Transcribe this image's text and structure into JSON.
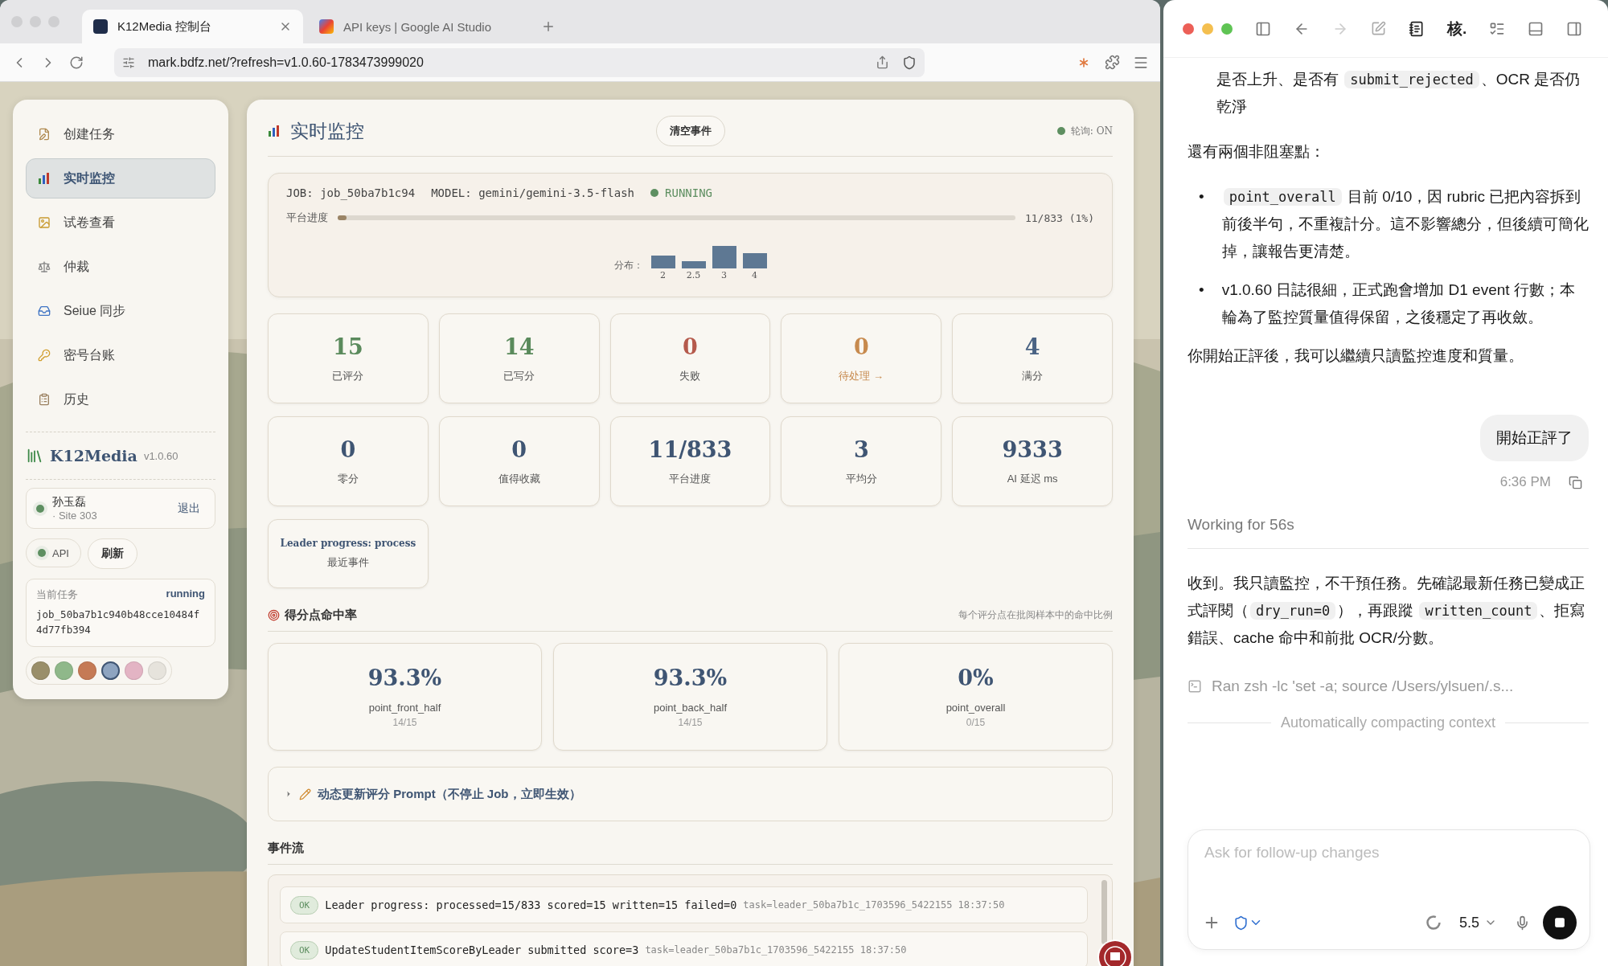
{
  "browser": {
    "tabs": [
      {
        "title": "K12Media 控制台",
        "selected": true
      },
      {
        "title": "API keys | Google AI Studio",
        "selected": false
      }
    ],
    "url": "mark.bdfz.net/?refresh=v1.0.60-1783473999020"
  },
  "sidebar": {
    "items": [
      {
        "label": "创建任务",
        "selected": false
      },
      {
        "label": "实时监控",
        "selected": true
      },
      {
        "label": "试卷查看",
        "selected": false
      },
      {
        "label": "仲裁",
        "selected": false
      },
      {
        "label": "Seiue 同步",
        "selected": false
      },
      {
        "label": "密号台账",
        "selected": false
      },
      {
        "label": "历史",
        "selected": false
      }
    ],
    "brand": {
      "name": "K12Media",
      "version": "v1.0.60"
    },
    "user": {
      "name": "孙玉磊",
      "site": "· Site 303",
      "logout": "退出"
    },
    "api_status": {
      "label": "API",
      "color": "#5e8f61"
    },
    "refresh": "刷新",
    "current_task": {
      "title": "当前任务",
      "status": "running",
      "job": "job_50ba7b1c940b48cce10484f4d77fb394"
    },
    "swatches": [
      {
        "color": "#9a8f6a",
        "selected": false
      },
      {
        "color": "#8fb88a",
        "selected": false
      },
      {
        "color": "#c57a55",
        "selected": false
      },
      {
        "color": "#8ea4c0",
        "selected": true
      },
      {
        "color": "#e3b4c4",
        "selected": false
      },
      {
        "color": "#e6e3dc",
        "selected": false
      }
    ]
  },
  "main": {
    "title": "实时监控",
    "clear_button": "清空事件",
    "polling": {
      "label": "轮询: ON",
      "color": "#5e8f61"
    },
    "job": {
      "job": "JOB: job_50ba7b1c94",
      "model": "MODEL: gemini/gemini-3.5-flash",
      "status": "RUNNING",
      "progress_label": "平台进度",
      "level": 0.013,
      "reading": "11/833 (1%)",
      "distribution_label": "分布：",
      "bins": [
        "2",
        "2.5",
        "3",
        "4"
      ]
    },
    "stats": [
      {
        "kind": "stat",
        "value": "15",
        "label": "已评分",
        "color": "#5a8a5c"
      },
      {
        "kind": "stat",
        "value": "14",
        "label": "已写分",
        "color": "#5a8a5c"
      },
      {
        "kind": "stat",
        "value": "0",
        "label": "失败",
        "color": "#b55a4c"
      },
      {
        "kind": "link",
        "value": "0",
        "label": "待处理 →",
        "color": "#c78a4e"
      },
      {
        "kind": "stat",
        "value": "4",
        "label": "满分",
        "color": "#4a6384"
      },
      {
        "kind": "stat",
        "value": "0",
        "label": "零分",
        "color": "#3f5573"
      },
      {
        "kind": "stat",
        "value": "0",
        "label": "值得收藏",
        "color": "#3f5573"
      },
      {
        "kind": "stat",
        "value": "11/833",
        "label": "平台进度",
        "color": "#3f5573"
      },
      {
        "kind": "stat",
        "value": "3",
        "label": "平均分",
        "color": "#3f5573"
      },
      {
        "kind": "stat",
        "value": "9333",
        "label": "AI 延迟 ms",
        "color": "#3f5573"
      },
      {
        "kind": "note",
        "value": "Leader progress: process",
        "label": "最近事件"
      }
    ],
    "hit_rate": {
      "title": "得分点命中率",
      "hint": "每个评分点在批阅样本中的命中比例",
      "cards": [
        {
          "value": "93.3%",
          "name": "point_front_half",
          "count": "14/15"
        },
        {
          "value": "93.3%",
          "name": "point_back_half",
          "count": "14/15"
        },
        {
          "value": "0%",
          "name": "point_overall",
          "count": "0/15"
        }
      ]
    },
    "prompt_update": {
      "label": "动态更新评分 Prompt（不停止 Job，立即生效）",
      "expanded": false
    },
    "events": {
      "title": "事件流",
      "items": [
        {
          "status": "OK",
          "message": "Leader progress: processed=15/833 scored=15 written=15 failed=0",
          "meta": "task=leader_50ba7b1c_1703596_5422155 18:37:50"
        },
        {
          "status": "OK",
          "message": "UpdateStudentItemScoreByLeader submitted score=3",
          "meta": "task=leader_50ba7b1c_1703596_5422155 18:37:50"
        }
      ]
    }
  },
  "chat": {
    "title": "核.",
    "blocks": [
      {
        "kind": "continuation",
        "segments": [
          {
            "kind": "text",
            "text": "是否上升、是否有 "
          },
          {
            "kind": "code",
            "text": "submit_rejected"
          },
          {
            "kind": "text",
            "text": "、OCR 是否仍乾淨"
          }
        ]
      },
      {
        "kind": "paragraph",
        "segments": [
          {
            "kind": "text",
            "text": "還有兩個非阻塞點："
          }
        ]
      },
      {
        "kind": "bullet",
        "marker": "•",
        "segments": [
          {
            "kind": "code",
            "text": "point_overall"
          },
          {
            "kind": "text",
            "text": " 目前 0/10，因 rubric 已把內容拆到前後半句，不重複計分。這不影響總分，但後續可簡化掉，讓報告更清楚。"
          }
        ]
      },
      {
        "kind": "bullet",
        "marker": "•",
        "segments": [
          {
            "kind": "text",
            "text": "v1.0.60 日誌很細，正式跑會增加 D1 event 行數；本輪為了監控質量值得保留，之後穩定了再收斂。"
          }
        ]
      },
      {
        "kind": "paragraph",
        "segments": [
          {
            "kind": "text",
            "text": "你開始正評後，我可以繼續只讀監控進度和質量。"
          }
        ]
      },
      {
        "kind": "user",
        "segments": [
          {
            "kind": "text",
            "text": "開始正評了"
          }
        ]
      },
      {
        "kind": "time",
        "segments": [
          {
            "kind": "text",
            "text": "6:36 PM"
          }
        ]
      },
      {
        "kind": "working",
        "segments": [
          {
            "kind": "text",
            "text": "Working for 56s"
          }
        ]
      },
      {
        "kind": "paragraph",
        "segments": [
          {
            "kind": "text",
            "text": "收到。我只讀監控，不干預任務。先確認最新任務已變成正式評閱（"
          },
          {
            "kind": "code",
            "text": "dry_run=0"
          },
          {
            "kind": "text",
            "text": "），再跟蹤 "
          },
          {
            "kind": "code",
            "text": "written_count"
          },
          {
            "kind": "text",
            "text": "、拒寫錯誤、cache 命中和前批 OCR/分數。"
          }
        ]
      },
      {
        "kind": "command",
        "segments": [
          {
            "kind": "text",
            "text": "Ran zsh -lc 'set -a; source /Users/ylsuen/.s..."
          }
        ]
      },
      {
        "kind": "notice",
        "segments": [
          {
            "kind": "text",
            "text": "Automatically compacting context"
          }
        ]
      }
    ],
    "composer": {
      "placeholder": "Ask for follow-up changes",
      "model": "5.5"
    }
  }
}
